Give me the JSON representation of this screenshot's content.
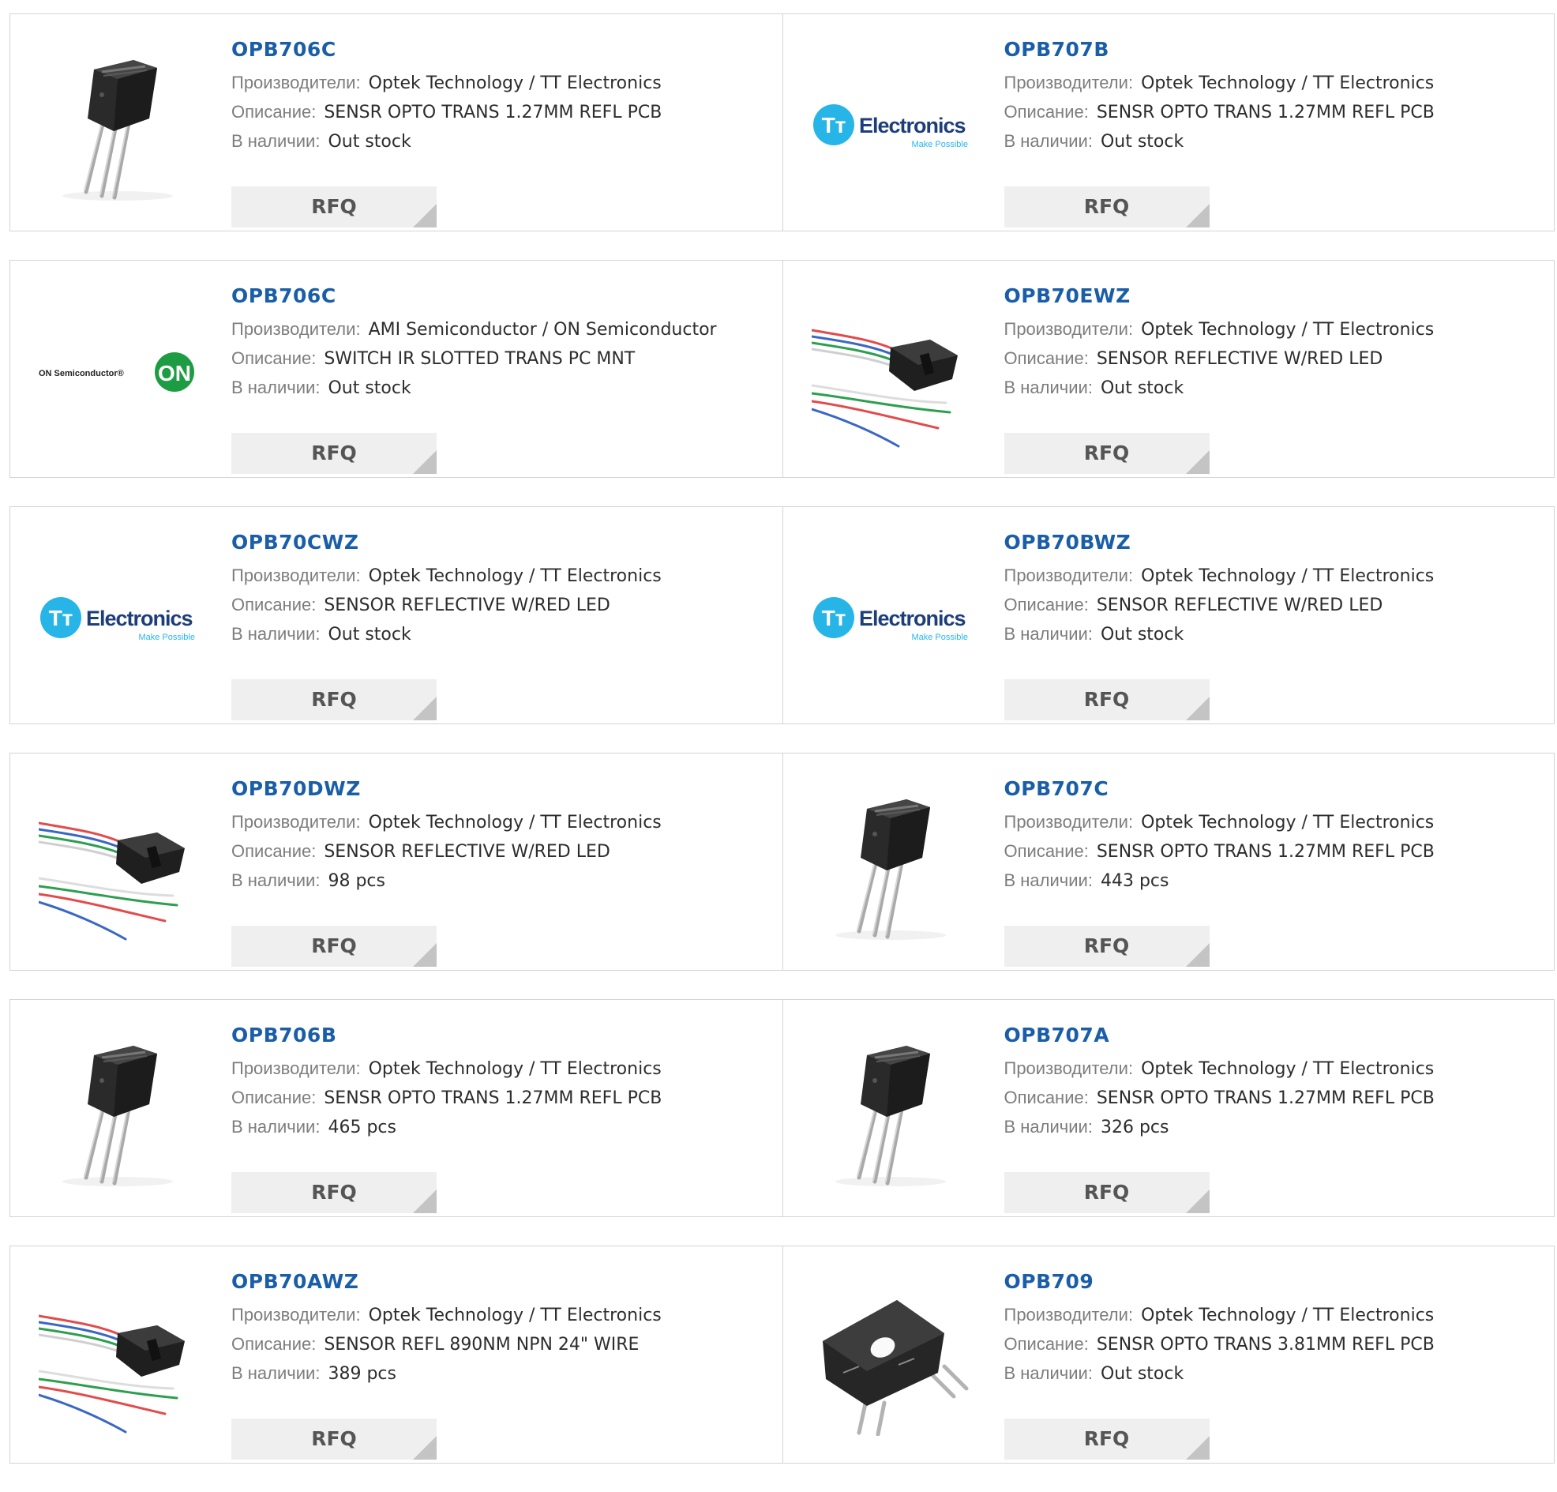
{
  "rfq_label": "RFQ",
  "labels": {
    "manufacturer": "Производители:",
    "description": "Описание:",
    "stock": "В наличии:"
  },
  "colors": {
    "title": "#1a5ea8",
    "rfq_bg": "#efefef",
    "border": "#d4d4d4",
    "tt_blue": "#27b5e8",
    "on_green": "#1e9c43"
  },
  "products": [
    {
      "part": "OPB706C",
      "manufacturer": "Optek Technology / TT Electronics",
      "description": "SENSR OPTO TRANS 1.27MM REFL PCB",
      "stock": "Out stock",
      "image": "sensor-photo"
    },
    {
      "part": "OPB707B",
      "manufacturer": "Optek Technology / TT Electronics",
      "description": "SENSR OPTO TRANS 1.27MM REFL PCB",
      "stock": "Out stock",
      "image": "tt-electronics-logo",
      "logo_text": "Electronics",
      "logo_tagline": "Make Possible"
    },
    {
      "part": "OPB706C",
      "manufacturer": "AMI Semiconductor / ON Semiconductor",
      "description": "SWITCH IR SLOTTED TRANS PC MNT",
      "stock": "Out stock",
      "image": "on-semiconductor-logo",
      "logo_text": "ON Semiconductor®",
      "logo_badge": "ON"
    },
    {
      "part": "OPB70EWZ",
      "manufacturer": "Optek Technology / TT Electronics",
      "description": "SENSOR REFLECTIVE W/RED LED",
      "stock": "Out stock",
      "image": "wired-sensor-photo"
    },
    {
      "part": "OPB70CWZ",
      "manufacturer": "Optek Technology / TT Electronics",
      "description": "SENSOR REFLECTIVE W/RED LED",
      "stock": "Out stock",
      "image": "tt-electronics-logo",
      "logo_text": "Electronics",
      "logo_tagline": "Make Possible"
    },
    {
      "part": "OPB70BWZ",
      "manufacturer": "Optek Technology / TT Electronics",
      "description": "SENSOR REFLECTIVE W/RED LED",
      "stock": "Out stock",
      "image": "tt-electronics-logo",
      "logo_text": "Electronics",
      "logo_tagline": "Make Possible"
    },
    {
      "part": "OPB70DWZ",
      "manufacturer": "Optek Technology / TT Electronics",
      "description": "SENSOR REFLECTIVE W/RED LED",
      "stock": "98 pcs",
      "image": "wired-sensor-photo"
    },
    {
      "part": "OPB707C",
      "manufacturer": "Optek Technology / TT Electronics",
      "description": "SENSR OPTO TRANS 1.27MM REFL PCB",
      "stock": "443 pcs",
      "image": "sensor-photo"
    },
    {
      "part": "OPB706B",
      "manufacturer": "Optek Technology / TT Electronics",
      "description": "SENSR OPTO TRANS 1.27MM REFL PCB",
      "stock": "465 pcs",
      "image": "sensor-photo"
    },
    {
      "part": "OPB707A",
      "manufacturer": "Optek Technology / TT Electronics",
      "description": "SENSR OPTO TRANS 1.27MM REFL PCB",
      "stock": "326 pcs",
      "image": "sensor-photo"
    },
    {
      "part": "OPB70AWZ",
      "manufacturer": "Optek Technology / TT Electronics",
      "description": "SENSOR REFL 890NM NPN 24\" WIRE",
      "stock": "389 pcs",
      "image": "wired-sensor-photo"
    },
    {
      "part": "OPB709",
      "manufacturer": "Optek Technology / TT Electronics",
      "description": "SENSR OPTO TRANS 3.81MM REFL PCB",
      "stock": "Out stock",
      "image": "slotted-sensor-photo"
    }
  ]
}
